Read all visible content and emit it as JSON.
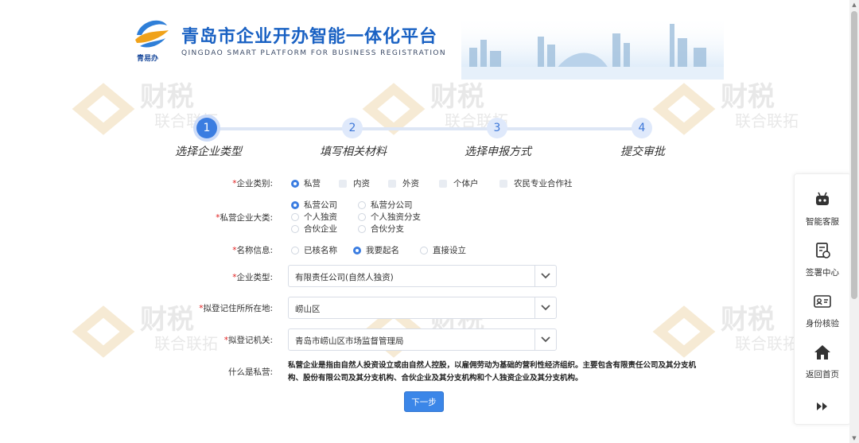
{
  "header": {
    "title": "青岛市企业开办智能一体化平台",
    "subtitle": "QINGDAO SMART PLATFORM FOR BUSINESS REGISTRATION",
    "logo_text": "青易办"
  },
  "watermark": {
    "big": "财税",
    "small": "联合联拓"
  },
  "steps": [
    {
      "num": "1",
      "label": "选择企业类型",
      "active": true
    },
    {
      "num": "2",
      "label": "填写相关材料",
      "active": false
    },
    {
      "num": "3",
      "label": "选择申报方式",
      "active": false
    },
    {
      "num": "4",
      "label": "提交审批",
      "active": false
    }
  ],
  "form": {
    "required_mark": "*",
    "enterprise_category": {
      "label": "企业类别:",
      "options": [
        "私营",
        "内资",
        "外资",
        "个体户",
        "农民专业合作社"
      ],
      "selected": "私营"
    },
    "private_category": {
      "label": "私营企业大类:",
      "options": [
        "私营公司",
        "私营分公司",
        "个人独资",
        "个人独资分支",
        "合伙企业",
        "合伙分支"
      ],
      "selected": "私营公司"
    },
    "name_info": {
      "label": "名称信息:",
      "options": [
        "已核名称",
        "我要起名",
        "直接设立"
      ],
      "selected": "我要起名"
    },
    "enterprise_type": {
      "label": "企业类型:",
      "value": "有限责任公司(自然人独资)"
    },
    "registered_address": {
      "label": "拟登记住所所在地:",
      "value": "崂山区"
    },
    "registration_authority": {
      "label": "拟登记机关:",
      "value": "青岛市崂山区市场监督管理局"
    },
    "what_is_private": {
      "label": "什么是私营:",
      "text": "私营企业是指由自然人投资设立或由自然人控股，以雇佣劳动为基础的营利性经济组织。主要包含有限责任公司及其分支机构、股份有限公司及其分支机构、合伙企业及其分支机构和个人独资企业及其分支机构。"
    },
    "next_button": "下一步"
  },
  "sidebar": {
    "items": [
      {
        "label": "智能客服",
        "icon": "robot-icon"
      },
      {
        "label": "签署中心",
        "icon": "sign-document-icon"
      },
      {
        "label": "身份核验",
        "icon": "id-card-icon"
      },
      {
        "label": "返回首页",
        "icon": "home-icon"
      }
    ]
  },
  "colors": {
    "primary": "#3b7de1",
    "title": "#1961c3",
    "required": "#e02020"
  }
}
